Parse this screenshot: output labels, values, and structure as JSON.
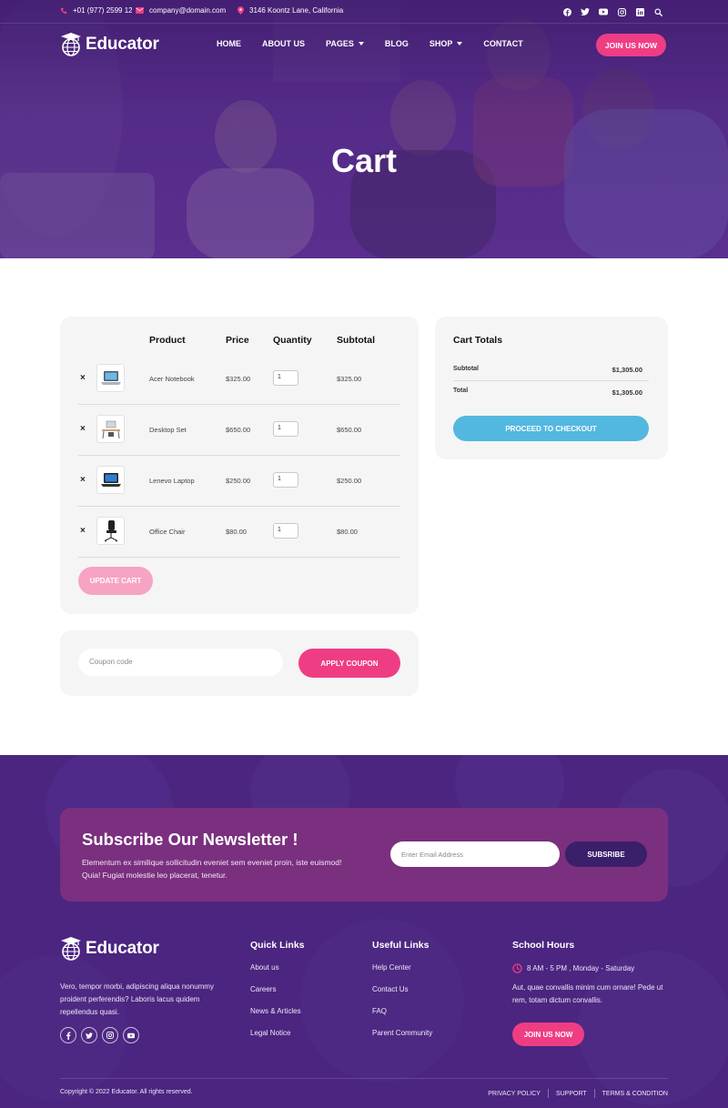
{
  "topbar": {
    "phone": "+01 (977) 2599 12",
    "email": "company@domain.com",
    "address": "3146 Koontz Lane, California",
    "social_icons": [
      "facebook-icon",
      "twitter-icon",
      "youtube-icon",
      "instagram-icon",
      "linkedin-icon",
      "search-icon"
    ]
  },
  "brand": {
    "name": "Educator"
  },
  "nav": {
    "items": [
      {
        "label": "HOME",
        "dropdown": false
      },
      {
        "label": "ABOUT US",
        "dropdown": false
      },
      {
        "label": "PAGES",
        "dropdown": true
      },
      {
        "label": "BLOG",
        "dropdown": false
      },
      {
        "label": "SHOP",
        "dropdown": true
      },
      {
        "label": "CONTACT",
        "dropdown": false
      }
    ],
    "cta": "JOIN US NOW"
  },
  "hero": {
    "title": "Cart"
  },
  "cart": {
    "headers": {
      "product": "Product",
      "price": "Price",
      "quantity": "Quantity",
      "subtotal": "Subtotal"
    },
    "remove_symbol": "×",
    "rows": [
      {
        "name": "Acer Notebook",
        "price": "$325.00",
        "qty": "1",
        "subtotal": "$325.00",
        "icon": "laptop-icon"
      },
      {
        "name": "Desktop Set",
        "price": "$650.00",
        "qty": "1",
        "subtotal": "$650.00",
        "icon": "desktop-set-icon"
      },
      {
        "name": "Lenevo Laptop",
        "price": "$250.00",
        "qty": "1",
        "subtotal": "$250.00",
        "icon": "laptop-dark-icon"
      },
      {
        "name": "Office Chair",
        "price": "$80.00",
        "qty": "1",
        "subtotal": "$80.00",
        "icon": "office-chair-icon"
      }
    ],
    "update_label": "UPDATE CART",
    "coupon_placeholder": "Coupon code",
    "apply_label": "APPLY COUPON"
  },
  "totals": {
    "title": "Cart Totals",
    "subtotal_label": "Subtotal",
    "subtotal_value": "$1,305.00",
    "total_label": "Total",
    "total_value": "$1,305.00",
    "checkout_label": "PROCEED TO CHECKOUT"
  },
  "newsletter": {
    "title": "Subscribe Our Newsletter !",
    "text": "Elementum ex similique sollicitudin eveniet sem eveniet proin, iste euismod! Quia! Fugiat molestie leo placerat, tenetur.",
    "placeholder": "Enter Email Address",
    "button": "SUBSRIBE"
  },
  "footer": {
    "about": "Vero, tempor morbi, adipiscing aliqua nonummy proident perferendis? Laboris lacus quidem repellendus quasi.",
    "social_icons": [
      "facebook-icon",
      "twitter-icon",
      "instagram-icon",
      "youtube-icon"
    ],
    "quick_links": {
      "title": "Quick Links",
      "items": [
        "About us",
        "Careers",
        "News & Articles",
        "Legal Notice"
      ]
    },
    "useful_links": {
      "title": "Useful Links",
      "items": [
        "Help Center",
        "Contact Us",
        "FAQ",
        "Parent Community"
      ]
    },
    "hours": {
      "title": "School Hours",
      "time": "8 AM - 5 PM , Monday - Saturday",
      "text": "Aut, quae convallis minim cum ornare! Pede ut rem, totam dictum convallis.",
      "button": "JOIN US NOW"
    },
    "copyright": "Copyright © 2022 Educator. All rights reserved.",
    "legal": [
      "PRIVACY POLICY",
      "SUPPORT",
      "TERMS & CONDITION"
    ]
  },
  "colors": {
    "primary_purple": "#4b2580",
    "accent_pink": "#ef3d84",
    "checkout_blue": "#53b8e0",
    "newsletter_bg": "#7b2f7f"
  }
}
